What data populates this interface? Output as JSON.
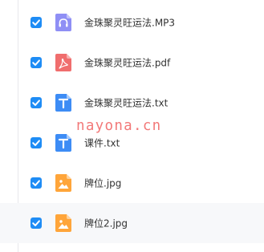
{
  "files": [
    {
      "name": "金珠聚灵旺运法.MP3",
      "icon": "audio-file-icon",
      "color": "#8f8ff5",
      "checked": true
    },
    {
      "name": "金珠聚灵旺运法.pdf",
      "icon": "pdf-file-icon",
      "color": "#f06e6e",
      "checked": true
    },
    {
      "name": "金珠聚灵旺运法.txt",
      "icon": "text-file-icon",
      "color": "#3d8cf5",
      "checked": true
    },
    {
      "name": "课件.txt",
      "icon": "text-file-icon",
      "color": "#3d8cf5",
      "checked": true
    },
    {
      "name": "牌位.jpg",
      "icon": "image-file-icon",
      "color": "#ffa53a",
      "checked": true
    },
    {
      "name": "牌位2.jpg",
      "icon": "image-file-icon",
      "color": "#ffa53a",
      "checked": true
    }
  ],
  "watermark": "nayona.cn",
  "colors": {
    "checkbox": "#1e8cf5",
    "text": "#333333",
    "watermark": "#ee4b4b"
  }
}
